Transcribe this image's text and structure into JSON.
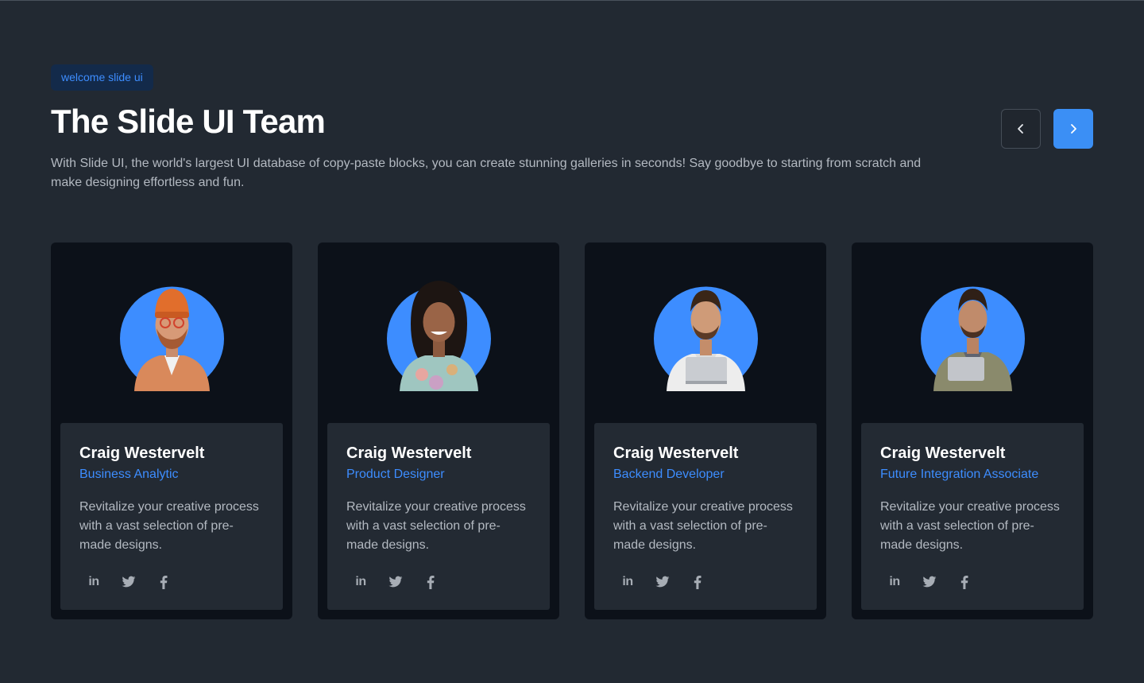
{
  "header": {
    "badge": "welcome slide ui",
    "title": "The Slide UI Team",
    "description": "With Slide UI, the world's largest UI database of copy-paste blocks, you can create stunning galleries in seconds! Say goodbye to starting from scratch and make designing effortless and fun."
  },
  "navigation": {
    "prev_icon": "chevron-left-icon",
    "next_icon": "chevron-right-icon"
  },
  "colors": {
    "background": "#222932",
    "card": "#0c1119",
    "card_body": "#232a33",
    "accent": "#3b8ff5",
    "avatar_circle": "#3d8dff"
  },
  "team": [
    {
      "name": "Craig Westervelt",
      "role": "Business Analytic",
      "bio": "Revitalize your creative process with a vast selection of pre-made designs.",
      "avatar": "man-with-orange-beanie-and-beard",
      "socials": [
        "linkedin-icon",
        "twitter-icon",
        "facebook-icon"
      ]
    },
    {
      "name": "Craig Westervelt",
      "role": "Product Designer",
      "bio": "Revitalize your creative process with a vast selection of pre-made designs.",
      "avatar": "woman-with-curly-hair-floral-shirt",
      "socials": [
        "linkedin-icon",
        "twitter-icon",
        "facebook-icon"
      ]
    },
    {
      "name": "Craig Westervelt",
      "role": "Backend Developer",
      "bio": "Revitalize your creative process with a vast selection of pre-made designs.",
      "avatar": "man-white-shirt-holding-laptop",
      "socials": [
        "linkedin-icon",
        "twitter-icon",
        "facebook-icon"
      ]
    },
    {
      "name": "Craig Westervelt",
      "role": "Future Integration Associate",
      "bio": "Revitalize your creative process with a vast selection of pre-made designs.",
      "avatar": "man-olive-jacket-holding-laptop",
      "socials": [
        "linkedin-icon",
        "twitter-icon",
        "facebook-icon"
      ]
    }
  ]
}
